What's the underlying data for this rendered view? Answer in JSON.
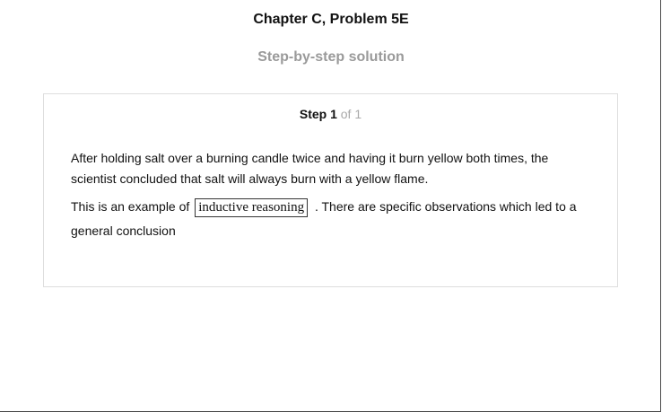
{
  "header": {
    "title": "Chapter C, Problem 5E",
    "subtitle": "Step-by-step solution"
  },
  "step": {
    "label": "Step 1",
    "of_text": "of 1",
    "paragraph1": "After holding salt over a burning candle twice and having it burn yellow both times, the scientist concluded that salt will always burn with a yellow flame.",
    "paragraph2_before": "This is an example of",
    "answer": "inductive reasoning",
    "paragraph2_after": ". There are specific observations which led to a general conclusion"
  }
}
